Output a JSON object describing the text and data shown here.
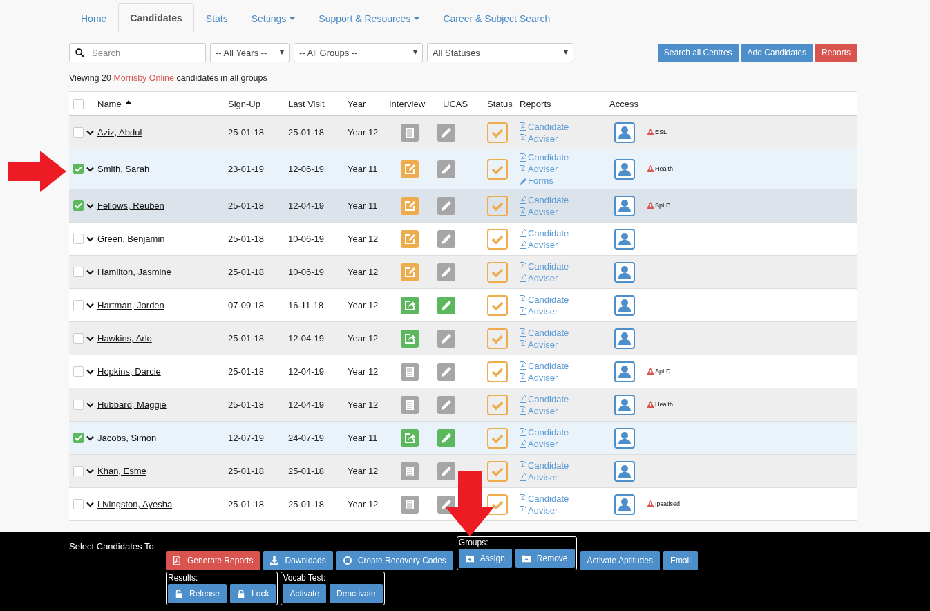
{
  "tabs": [
    {
      "label": "Home",
      "selected": false,
      "dropdown": false
    },
    {
      "label": "Candidates",
      "selected": true,
      "dropdown": false
    },
    {
      "label": "Stats",
      "selected": false,
      "dropdown": false
    },
    {
      "label": "Settings",
      "selected": false,
      "dropdown": true
    },
    {
      "label": "Support & Resources",
      "selected": false,
      "dropdown": true
    },
    {
      "label": "Career & Subject Search",
      "selected": false,
      "dropdown": false
    }
  ],
  "filters": {
    "search_placeholder": "Search",
    "selects": [
      "-- All Years --",
      "-- All Groups --",
      "All Statuses"
    ]
  },
  "actions": [
    {
      "label": "Search all Centres",
      "kind": "primary"
    },
    {
      "label": "Add Candidates",
      "kind": "primary"
    },
    {
      "label": "Reports",
      "kind": "danger"
    }
  ],
  "summary": {
    "before": "Viewing 20",
    "highlight": "Morrisby Online",
    "after": "candidates in all groups"
  },
  "table": {
    "all_selected": false,
    "columns": [
      "Name",
      "Sign-Up",
      "Last Visit",
      "Year",
      "Interview",
      "UCAS",
      "Status",
      "Reports",
      "Access"
    ],
    "rows": [
      {
        "selected": false,
        "name": "Aziz, Abdul",
        "signup": "25-01-18",
        "last_visit": "25-01-18",
        "year": "Year 12",
        "interview": {
          "kind": "list"
        },
        "ucas_done": false,
        "reports": [
          "Candidate",
          "Adviser"
        ],
        "tag": "ESL"
      },
      {
        "selected": true,
        "name": "Smith, Sarah",
        "signup": "23-01-19",
        "last_visit": "12-06-19",
        "year": "Year 11",
        "interview": {
          "kind": "edit"
        },
        "ucas_done": false,
        "reports": [
          "Candidate",
          "Adviser"
        ],
        "forms": "Forms",
        "tag": "Health"
      },
      {
        "selected": true,
        "name": "Fellows, Reuben",
        "signup": "25-01-18",
        "last_visit": "12-04-19",
        "year": "Year 11",
        "interview": {
          "kind": "edit"
        },
        "ucas_done": false,
        "reports": [
          "Candidate",
          "Adviser"
        ],
        "tag": "SpLD"
      },
      {
        "selected": false,
        "name": "Green, Benjamin",
        "signup": "25-01-18",
        "last_visit": "10-06-19",
        "year": "Year 12",
        "interview": {
          "kind": "edit"
        },
        "ucas_done": false,
        "reports": [
          "Candidate",
          "Adviser"
        ]
      },
      {
        "selected": false,
        "name": "Hamilton, Jasmine",
        "signup": "25-01-18",
        "last_visit": "10-06-19",
        "year": "Year 12",
        "interview": {
          "kind": "edit"
        },
        "ucas_done": false,
        "reports": [
          "Candidate",
          "Adviser"
        ]
      },
      {
        "selected": false,
        "name": "Hartman, Jorden",
        "signup": "07-09-18",
        "last_visit": "16-11-18",
        "year": "Year 12",
        "interview": {
          "kind": "share"
        },
        "ucas_done": true,
        "reports": [
          "Candidate",
          "Adviser"
        ]
      },
      {
        "selected": false,
        "name": "Hawkins, Arlo",
        "signup": "25-01-18",
        "last_visit": "12-04-19",
        "year": "Year 12",
        "interview": {
          "kind": "share"
        },
        "ucas_done": false,
        "reports": [
          "Candidate",
          "Adviser"
        ]
      },
      {
        "selected": false,
        "name": "Hopkins, Darcie",
        "signup": "25-01-18",
        "last_visit": "12-04-19",
        "year": "Year 12",
        "interview": {
          "kind": "list"
        },
        "ucas_done": false,
        "reports": [
          "Candidate",
          "Adviser"
        ],
        "tag": "SpLD"
      },
      {
        "selected": false,
        "name": "Hubbard, Maggie",
        "signup": "25-01-18",
        "last_visit": "12-04-19",
        "year": "Year 12",
        "interview": {
          "kind": "list"
        },
        "ucas_done": false,
        "reports": [
          "Candidate",
          "Adviser"
        ],
        "tag": "Health"
      },
      {
        "selected": true,
        "name": "Jacobs, Simon",
        "signup": "12-07-19",
        "last_visit": "24-07-19",
        "year": "Year 11",
        "interview": {
          "kind": "share"
        },
        "ucas_done": true,
        "reports": [
          "Candidate",
          "Adviser"
        ]
      },
      {
        "selected": false,
        "name": "Khan, Esme",
        "signup": "25-01-18",
        "last_visit": "25-01-18",
        "year": "Year 12",
        "interview": {
          "kind": "list"
        },
        "ucas_done": false,
        "reports": [
          "Candidate",
          "Adviser"
        ]
      },
      {
        "selected": false,
        "name": "Livingston, Ayesha",
        "signup": "25-01-18",
        "last_visit": "25-01-18",
        "year": "Year 12",
        "interview": {
          "kind": "list"
        },
        "ucas_done": false,
        "reports": [
          "Candidate",
          "Adviser"
        ],
        "tag": "Ipsatised"
      }
    ]
  },
  "action_bar": {
    "title": "Select Candidates To:",
    "row1": [
      {
        "kind": "button",
        "label": "Generate Reports",
        "color": "#d9534f"
      },
      {
        "kind": "button",
        "label": "Downloads",
        "color": "#4d8fca"
      },
      {
        "kind": "button",
        "label": "Create Recovery Codes",
        "color": "#4d8fca"
      },
      {
        "kind": "group",
        "label": "Groups:",
        "buttons": [
          {
            "label": "Assign"
          },
          {
            "label": "Remove"
          }
        ]
      },
      {
        "kind": "button",
        "label": "Activate Aptitudes",
        "color": "#4d8fca"
      },
      {
        "kind": "button",
        "label": "Email",
        "color": "#4d8fca"
      }
    ],
    "row2": [
      {
        "kind": "group",
        "label": "Results:",
        "buttons": [
          {
            "label": "Release"
          },
          {
            "label": "Lock"
          }
        ]
      },
      {
        "kind": "group",
        "label": "Vocab Test:",
        "buttons": [
          {
            "label": "Activate"
          },
          {
            "label": "Deactivate"
          }
        ]
      }
    ]
  }
}
